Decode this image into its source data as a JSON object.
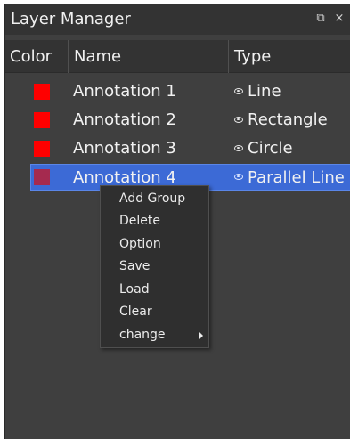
{
  "panel": {
    "title": "Layer Manager",
    "restore_icon": "restore-window-icon",
    "restore_glyph": "⧉",
    "close_icon": "close-icon",
    "close_glyph": "×"
  },
  "table": {
    "columns": [
      "Color",
      "Name",
      "Type"
    ],
    "rows": [
      {
        "color": "#ff0000",
        "name": "Annotation 1",
        "visibility_icon": "eye-icon",
        "type": "Line",
        "selected": false
      },
      {
        "color": "#ff0000",
        "name": "Annotation 2",
        "visibility_icon": "eye-icon",
        "type": "Rectangle",
        "selected": false
      },
      {
        "color": "#ff0000",
        "name": "Annotation 3",
        "visibility_icon": "eye-icon",
        "type": "Circle",
        "selected": false
      },
      {
        "color": "#a52a4f",
        "name": "Annotation 4",
        "visibility_icon": "eye-icon",
        "type": "Parallel Line",
        "selected": true
      }
    ]
  },
  "context_menu": {
    "items": [
      {
        "label": "Add Group"
      },
      {
        "label": "Delete"
      },
      {
        "label": "Option"
      },
      {
        "label": "Save"
      },
      {
        "label": "Load"
      },
      {
        "label": "Clear"
      },
      {
        "label": "change",
        "has_submenu": true,
        "submenu_icon": "submenu-arrow-icon"
      }
    ]
  },
  "colors": {
    "panel_background": "#3f3f3f",
    "header_background": "#333333",
    "selection": "#3c6ad6",
    "menu_background": "#2f2f2f"
  }
}
